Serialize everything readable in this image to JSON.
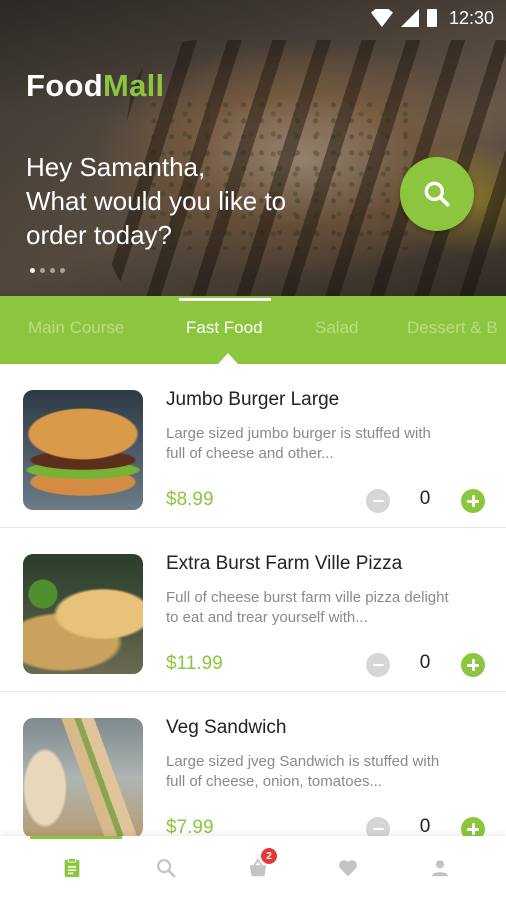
{
  "status_bar": {
    "time": "12:30"
  },
  "brand": {
    "part1": "Food",
    "part2": "Mall"
  },
  "hero": {
    "greeting_line1": "Hey Samantha,",
    "greeting_line2": "What would you like to",
    "greeting_line3": "order today?",
    "slide_count": 4,
    "active_slide": 1
  },
  "categories": {
    "tabs": [
      "Main Course",
      "Fast Food",
      "Salad",
      "Dessert & B"
    ],
    "active": "Fast Food"
  },
  "items": [
    {
      "name": "Jumbo Burger Large",
      "desc_line1": "Large sized jumbo burger is stuffed with",
      "desc_line2": "full of cheese and other...",
      "price": "$8.99",
      "qty": "0"
    },
    {
      "name": "Extra Burst Farm Ville Pizza",
      "desc_line1": "Full of cheese burst farm ville pizza delight",
      "desc_line2": "to eat and trear yourself with...",
      "price": "$11.99",
      "qty": "0"
    },
    {
      "name": "Veg Sandwich",
      "desc_line1": "Large sized jveg Sandwich is stuffed with",
      "desc_line2": "full of cheese, onion, tomatoes...",
      "price": "$7.99",
      "qty": "0"
    }
  ],
  "bottom_nav": {
    "items": [
      "menu-icon",
      "search-icon",
      "cart-icon",
      "heart-icon",
      "profile-icon"
    ],
    "active": "menu-icon",
    "cart_badge": "2"
  },
  "colors": {
    "accent": "#8cc63f",
    "badge": "#e53935"
  }
}
